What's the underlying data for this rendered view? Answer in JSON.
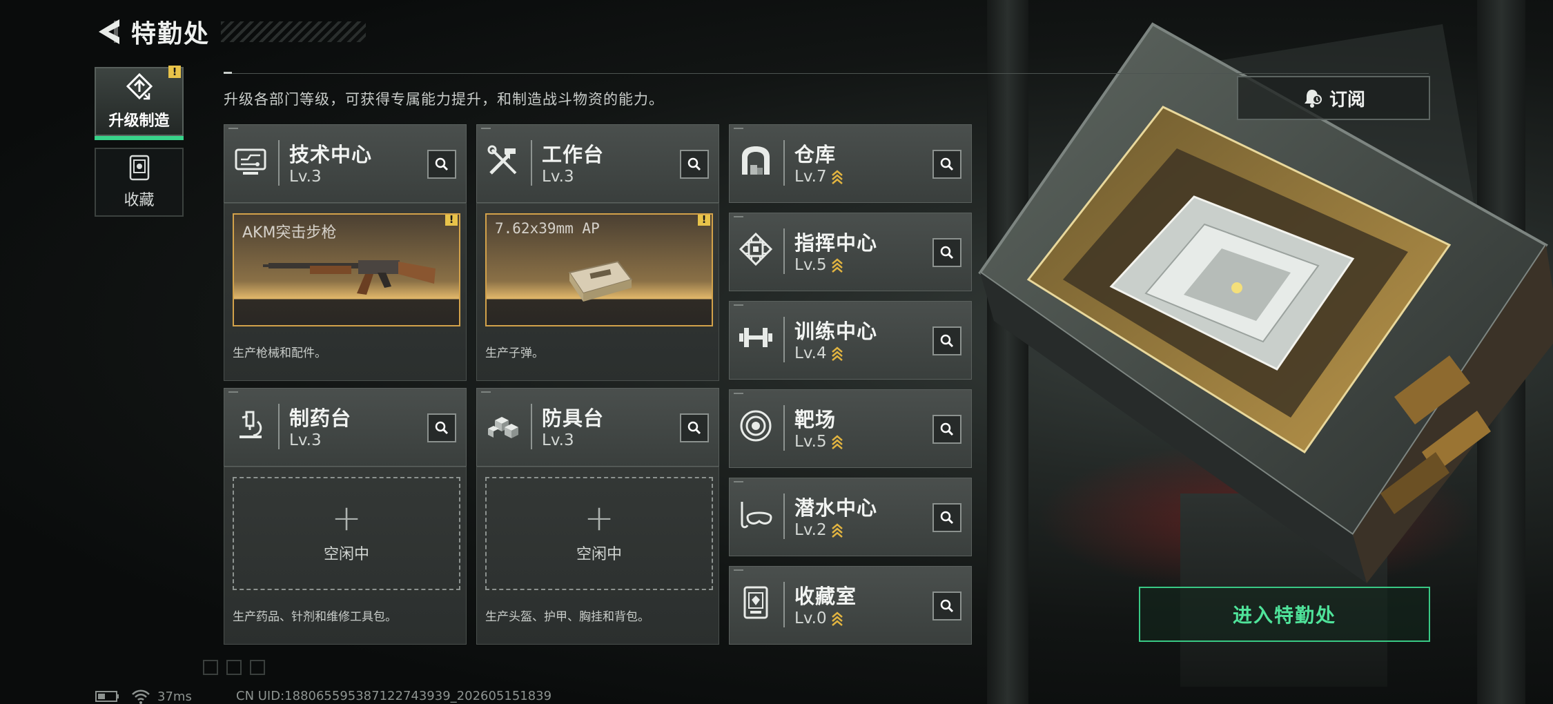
{
  "header": {
    "title": "特勤处"
  },
  "nav": [
    {
      "label": "升级制造",
      "active": true,
      "warning": "!"
    },
    {
      "label": "收藏",
      "active": false
    }
  ],
  "description": "升级各部门等级，可获得专属能力提升，和制造战斗物资的能力。",
  "subscribe_label": "订阅",
  "departments": {
    "tech": {
      "name": "技术中心",
      "level": "Lv.3"
    },
    "workbench": {
      "name": "工作台",
      "level": "Lv.3"
    },
    "pharmacy": {
      "name": "制药台",
      "level": "Lv.3"
    },
    "armor": {
      "name": "防具台",
      "level": "Lv.3"
    },
    "warehouse": {
      "name": "仓库",
      "level": "Lv.7"
    },
    "command": {
      "name": "指挥中心",
      "level": "Lv.5"
    },
    "training": {
      "name": "训练中心",
      "level": "Lv.4"
    },
    "range": {
      "name": "靶场",
      "level": "Lv.5"
    },
    "diving": {
      "name": "潜水中心",
      "level": "Lv.2"
    },
    "collection": {
      "name": "收藏室",
      "level": "Lv.0"
    }
  },
  "production": {
    "tech": {
      "item": "AKM突击步枪",
      "warning": "!",
      "desc": "生产枪械和配件。"
    },
    "workbench": {
      "item": "7.62x39mm AP",
      "warning": "!",
      "desc": "生产子弹。"
    },
    "pharmacy": {
      "idle": "空闲中",
      "desc": "生产药品、针剂和维修工具包。"
    },
    "armor": {
      "idle": "空闲中",
      "desc": "生产头盔、护甲、胸挂和背包。"
    }
  },
  "enter_label": "进入特勤处",
  "status": {
    "ping": "37ms",
    "uid": "CN UID:188065595387122743939_202605151839"
  },
  "colors": {
    "accent_green": "#38d38a",
    "gold": "#d3a24a",
    "warning": "#e8c34a"
  }
}
